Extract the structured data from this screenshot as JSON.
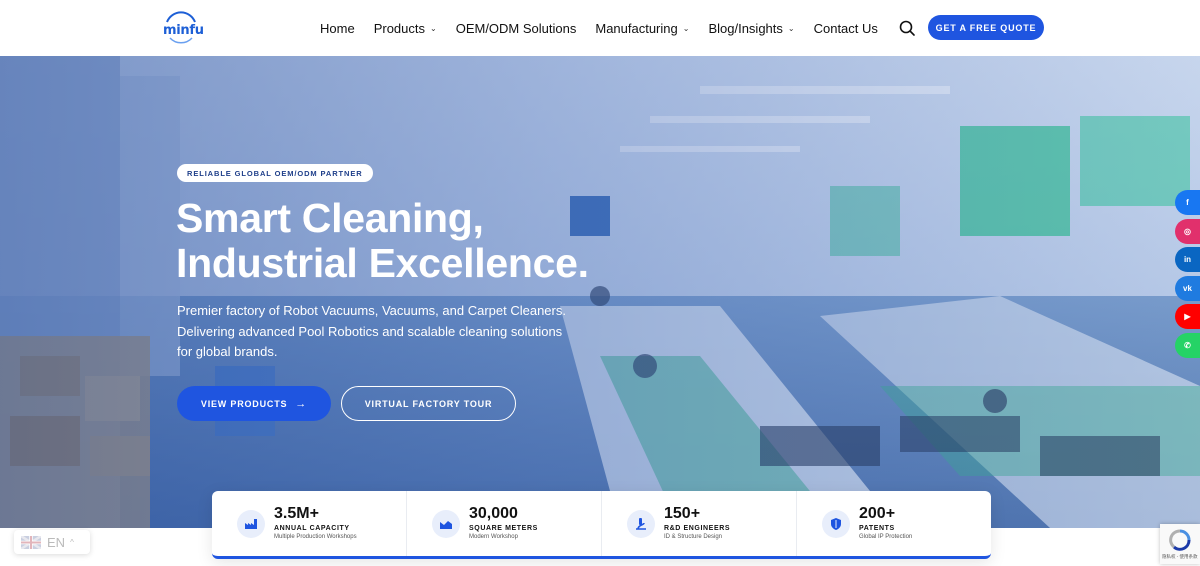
{
  "header": {
    "logo_text": "minfu",
    "nav": [
      {
        "label": "Home",
        "dropdown": false
      },
      {
        "label": "Products",
        "dropdown": true
      },
      {
        "label": "OEM/ODM Solutions",
        "dropdown": false
      },
      {
        "label": "Manufacturing",
        "dropdown": true
      },
      {
        "label": "Blog/Insights",
        "dropdown": true
      },
      {
        "label": "Contact Us",
        "dropdown": false
      }
    ],
    "search_icon": "search-icon",
    "quote_button": "GET A FREE QUOTE"
  },
  "hero": {
    "badge": "RELIABLE GLOBAL OEM/ODM PARTNER",
    "title_line1": "Smart Cleaning,",
    "title_line2": "Industrial Excellence.",
    "desc_line1": "Premier factory of Robot Vacuums, Vacuums, and Carpet Cleaners.",
    "desc_line2": "Delivering advanced Pool Robotics and scalable cleaning solutions",
    "desc_line3": "for global brands.",
    "primary_button": "VIEW PRODUCTS",
    "secondary_button": "VIRTUAL FACTORY TOUR"
  },
  "social": [
    {
      "name": "facebook-icon",
      "color": "#1877f2",
      "glyph": "f"
    },
    {
      "name": "instagram-icon",
      "color": "#e1306c",
      "glyph": "◎"
    },
    {
      "name": "linkedin-icon",
      "color": "#0a66c2",
      "glyph": "in"
    },
    {
      "name": "vk-icon",
      "color": "#1f7be0",
      "glyph": "vk"
    },
    {
      "name": "youtube-icon",
      "color": "#ff0000",
      "glyph": "▶"
    },
    {
      "name": "whatsapp-icon",
      "color": "#25d366",
      "glyph": "✆"
    }
  ],
  "stats": [
    {
      "value": "3.5M+",
      "label": "ANNUAL CAPACITY",
      "sub": "Multiple Production Workshops",
      "icon": "factory-icon"
    },
    {
      "value": "30,000",
      "label": "SQUARE METERS",
      "sub": "Modern Workshop",
      "icon": "chart-area-icon"
    },
    {
      "value": "150+",
      "label": "R&D ENGINEERS",
      "sub": "ID & Structure Design",
      "icon": "microscope-icon"
    },
    {
      "value": "200+",
      "label": "PATENTS",
      "sub": "Global IP Protection",
      "icon": "shield-icon"
    }
  ],
  "language": {
    "code": "EN"
  },
  "recaptcha": {
    "text": "隐私权 - 使用条款"
  },
  "colors": {
    "accent": "#1f55e0",
    "brand": "#1d5fd6",
    "badge_text": "#1f3f8a"
  }
}
